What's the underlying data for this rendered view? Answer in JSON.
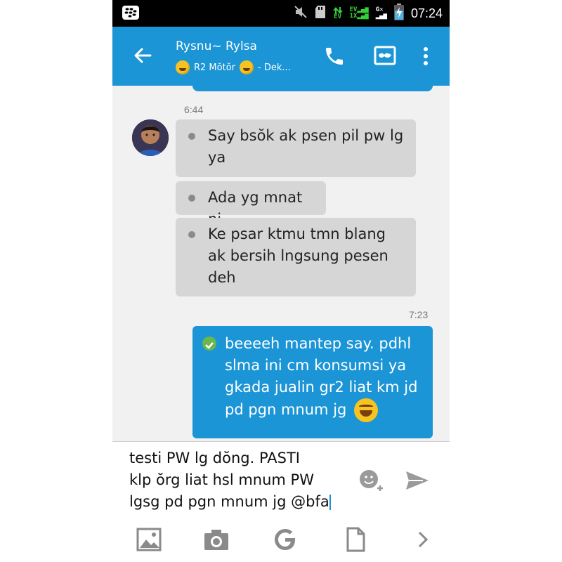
{
  "status_bar": {
    "net_top": "EV",
    "net_bottom": "1X",
    "net_gsm": "G",
    "time": "07:24"
  },
  "header": {
    "contact_name": "Rysnu~ Rylsa",
    "contact_status_text": "R2 Mŏtŏr",
    "contact_status_suffix": "- Dek..."
  },
  "chat": {
    "incoming_time": "6:44",
    "incoming_messages": [
      "Say bsŏk ak psen pil pw lg ya",
      "Ada yg mnat ni",
      "Ke psar ktmu tmn blang ak bersih  lngsung pesen deh"
    ],
    "outgoing_time": "7:23",
    "outgoing_message": "beeeeh mantep say. pdhl slma ini cm konsumsi ya gkada jualin gr2 liat km jd pd pgn mnum jg"
  },
  "composer": {
    "draft_text": "testi PW lg dŏng. PASTI\nklp ŏrg liat hsl mnum PW\nlgsg pd pgn mnum jg @bfa"
  },
  "icons": {
    "status": [
      "blackberry-icon",
      "mute-icon",
      "sd-card-icon",
      "data-arrows-icon",
      "battery-charging-icon"
    ],
    "header": [
      "back-arrow-icon",
      "phone-icon",
      "mask-icon",
      "overflow-menu-icon"
    ],
    "composer": [
      "emoji-add-icon",
      "send-icon"
    ],
    "attachments": [
      "image-icon",
      "camera-icon",
      "google-icon",
      "file-icon",
      "chevron-right-icon"
    ]
  },
  "colors": {
    "accent": "#1b95d6",
    "incoming_bubble": "#d6d6d6",
    "chat_background": "#f1f1f1",
    "status_green": "#34d23a"
  }
}
